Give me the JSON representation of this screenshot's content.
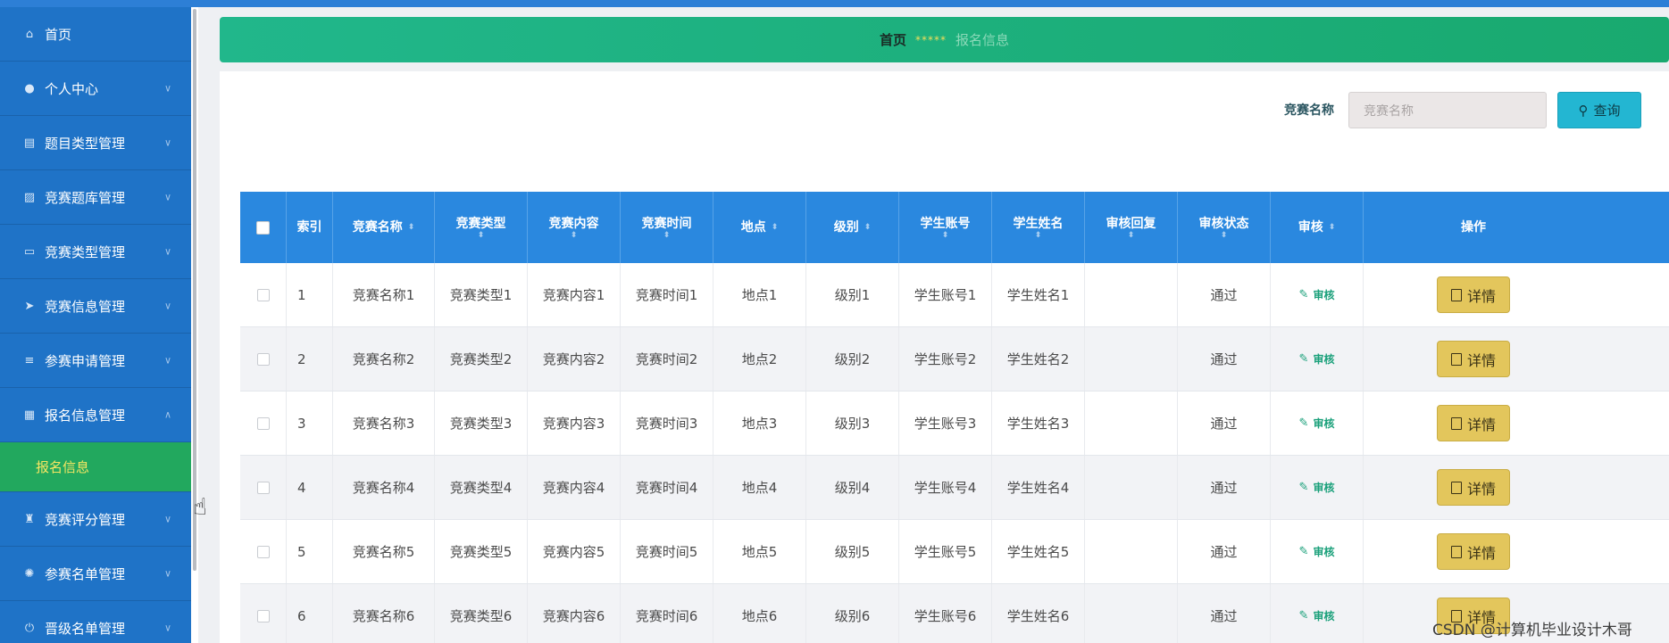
{
  "sidebar": {
    "items": [
      {
        "label": "首页",
        "icon": "home-icon",
        "chevron": false
      },
      {
        "label": "个人中心",
        "icon": "user-icon",
        "chevron": true
      },
      {
        "label": "题目类型管理",
        "icon": "clipboard-icon",
        "chevron": true
      },
      {
        "label": "竞赛题库管理",
        "icon": "image-icon",
        "chevron": true
      },
      {
        "label": "竞赛类型管理",
        "icon": "monitor-icon",
        "chevron": true
      },
      {
        "label": "竞赛信息管理",
        "icon": "send-icon",
        "chevron": true
      },
      {
        "label": "参赛申请管理",
        "icon": "list-icon",
        "chevron": true
      },
      {
        "label": "报名信息管理",
        "icon": "chart-icon",
        "chevron": true,
        "expanded": true
      }
    ],
    "subitem": {
      "label": "报名信息"
    },
    "items_after": [
      {
        "label": "竞赛评分管理",
        "icon": "trophy-icon",
        "chevron": true
      },
      {
        "label": "参赛名单管理",
        "icon": "aperture-icon",
        "chevron": true
      },
      {
        "label": "晋级名单管理",
        "icon": "power-icon",
        "chevron": true
      }
    ]
  },
  "breadcrumb": {
    "home": "首页",
    "stars": "*****",
    "current": "报名信息"
  },
  "search": {
    "label": "竞赛名称",
    "placeholder": "竞赛名称",
    "button": "查询"
  },
  "table": {
    "headers": [
      "索引",
      "竞赛名称",
      "竞赛类型",
      "竞赛内容",
      "竞赛时间",
      "地点",
      "级别",
      "学生账号",
      "学生姓名",
      "审核回复",
      "审核状态",
      "审核",
      "操作"
    ],
    "rows": [
      {
        "index": "1",
        "name": "竞赛名称1",
        "type": "竞赛类型1",
        "content": "竞赛内容1",
        "time": "竞赛时间1",
        "place": "地点1",
        "level": "级别1",
        "account": "学生账号1",
        "student": "学生姓名1",
        "reply": "",
        "status": "通过",
        "audit": "审核",
        "action": "详情"
      },
      {
        "index": "2",
        "name": "竞赛名称2",
        "type": "竞赛类型2",
        "content": "竞赛内容2",
        "time": "竞赛时间2",
        "place": "地点2",
        "level": "级别2",
        "account": "学生账号2",
        "student": "学生姓名2",
        "reply": "",
        "status": "通过",
        "audit": "审核",
        "action": "详情"
      },
      {
        "index": "3",
        "name": "竞赛名称3",
        "type": "竞赛类型3",
        "content": "竞赛内容3",
        "time": "竞赛时间3",
        "place": "地点3",
        "level": "级别3",
        "account": "学生账号3",
        "student": "学生姓名3",
        "reply": "",
        "status": "通过",
        "audit": "审核",
        "action": "详情"
      },
      {
        "index": "4",
        "name": "竞赛名称4",
        "type": "竞赛类型4",
        "content": "竞赛内容4",
        "time": "竞赛时间4",
        "place": "地点4",
        "level": "级别4",
        "account": "学生账号4",
        "student": "学生姓名4",
        "reply": "",
        "status": "通过",
        "audit": "审核",
        "action": "详情"
      },
      {
        "index": "5",
        "name": "竞赛名称5",
        "type": "竞赛类型5",
        "content": "竞赛内容5",
        "time": "竞赛时间5",
        "place": "地点5",
        "level": "级别5",
        "account": "学生账号5",
        "student": "学生姓名5",
        "reply": "",
        "status": "通过",
        "audit": "审核",
        "action": "详情"
      },
      {
        "index": "6",
        "name": "竞赛名称6",
        "type": "竞赛类型6",
        "content": "竞赛内容6",
        "time": "竞赛时间6",
        "place": "地点6",
        "level": "级别6",
        "account": "学生账号6",
        "student": "学生姓名6",
        "reply": "",
        "status": "通过",
        "audit": "审核",
        "action": "详情"
      }
    ]
  },
  "watermark": "CSDN @计算机毕业设计木哥",
  "colors": {
    "sidebar": "#1f73c7",
    "active_submenu": "#22a85e",
    "table_header": "#2a88df",
    "detail_button": "#e3c65c",
    "search_button": "#23b6d2"
  }
}
